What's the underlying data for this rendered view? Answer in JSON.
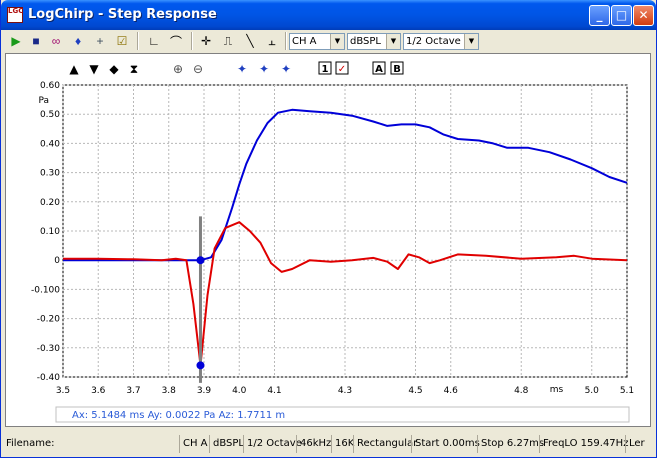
{
  "window": {
    "title": "LogChirp - Step Response",
    "icon_text": "LGC",
    "minimize": "_",
    "maximize": "□",
    "close": "✕"
  },
  "toolbar": {
    "icons": [
      {
        "name": "play-icon",
        "glyph": "▶",
        "color": "#1a9a1a"
      },
      {
        "name": "save-icon",
        "glyph": "■",
        "color": "#1a2a88"
      },
      {
        "name": "loop-icon",
        "glyph": "∞",
        "color": "#a01070"
      },
      {
        "name": "mic-icon",
        "glyph": "♦",
        "color": "#2040c0"
      },
      {
        "name": "crosshair-icon",
        "glyph": "+",
        "color": "#405060"
      },
      {
        "name": "check-icon",
        "glyph": "☑",
        "color": "#8a7000"
      },
      {
        "name": "impulse-axis-icon",
        "glyph": "∟",
        "color": "#000"
      },
      {
        "name": "curve-icon",
        "glyph": "⌒",
        "color": "#000"
      },
      {
        "name": "cursor-cross-icon",
        "glyph": "✛",
        "color": "#000"
      },
      {
        "name": "step-icon",
        "glyph": "⎍",
        "color": "#000"
      },
      {
        "name": "slope-icon",
        "glyph": "╲",
        "color": "#000"
      },
      {
        "name": "waterfall-icon",
        "glyph": "⫠",
        "color": "#000"
      }
    ],
    "channel": "CH A",
    "units": "dBSPL",
    "smoothing": "1/2 Octave"
  },
  "plot_toolbar": {
    "icons": [
      "▲",
      "▼",
      "◆",
      "⧗",
      "⊕",
      "⊖",
      "✦",
      "✦",
      "✦"
    ],
    "box1": "1",
    "box_check": "✓",
    "boxA": "A",
    "boxB": "B"
  },
  "chart_data": {
    "type": "line",
    "title": "",
    "xlabel": "ms",
    "ylabel": "Pa",
    "xlim": [
      3.5,
      5.1
    ],
    "ylim": [
      -0.4,
      0.6
    ],
    "grid": true,
    "x_ticks": [
      3.5,
      3.6,
      3.7,
      3.8,
      3.9,
      4.0,
      4.1,
      4.3,
      4.5,
      4.6,
      4.8,
      5.0,
      5.1
    ],
    "x_tick_labels": [
      "3.5",
      "3.6",
      "3.7",
      "3.8",
      "3.9",
      "4.0",
      "4.1",
      "4.3",
      "4.5",
      "4.6",
      "4.8",
      "5.0",
      "5.1"
    ],
    "y_ticks": [
      0.6,
      0.5,
      0.4,
      0.3,
      0.2,
      0.1,
      0.0,
      -0.1,
      -0.2,
      -0.3,
      -0.4
    ],
    "y_tick_labels": [
      "0.60",
      "0.50",
      "0.40",
      "0.30",
      "0.20",
      "0.10",
      "0",
      "-0.100",
      "-0.20",
      "-0.30",
      "-0.40"
    ],
    "series": [
      {
        "color": "#0000d8",
        "points": [
          [
            3.5,
            0.0
          ],
          [
            3.7,
            0.0
          ],
          [
            3.85,
            0.0
          ],
          [
            3.89,
            0.0
          ],
          [
            3.92,
            0.01
          ],
          [
            3.95,
            0.07
          ],
          [
            3.98,
            0.18
          ],
          [
            4.0,
            0.26
          ],
          [
            4.02,
            0.33
          ],
          [
            4.05,
            0.41
          ],
          [
            4.08,
            0.47
          ],
          [
            4.11,
            0.505
          ],
          [
            4.15,
            0.515
          ],
          [
            4.2,
            0.51
          ],
          [
            4.26,
            0.505
          ],
          [
            4.32,
            0.495
          ],
          [
            4.38,
            0.475
          ],
          [
            4.42,
            0.46
          ],
          [
            4.46,
            0.465
          ],
          [
            4.5,
            0.465
          ],
          [
            4.54,
            0.455
          ],
          [
            4.58,
            0.43
          ],
          [
            4.62,
            0.415
          ],
          [
            4.68,
            0.41
          ],
          [
            4.72,
            0.4
          ],
          [
            4.76,
            0.385
          ],
          [
            4.82,
            0.385
          ],
          [
            4.88,
            0.37
          ],
          [
            4.94,
            0.345
          ],
          [
            5.0,
            0.315
          ],
          [
            5.05,
            0.285
          ],
          [
            5.1,
            0.265
          ]
        ]
      },
      {
        "color": "#e00000",
        "points": [
          [
            3.5,
            0.005
          ],
          [
            3.6,
            0.005
          ],
          [
            3.7,
            0.003
          ],
          [
            3.78,
            0.0
          ],
          [
            3.82,
            0.005
          ],
          [
            3.85,
            0.0
          ],
          [
            3.87,
            -0.15
          ],
          [
            3.89,
            -0.36
          ],
          [
            3.91,
            -0.12
          ],
          [
            3.93,
            0.04
          ],
          [
            3.96,
            0.11
          ],
          [
            4.0,
            0.13
          ],
          [
            4.03,
            0.1
          ],
          [
            4.06,
            0.06
          ],
          [
            4.09,
            -0.01
          ],
          [
            4.12,
            -0.04
          ],
          [
            4.15,
            -0.03
          ],
          [
            4.2,
            0.0
          ],
          [
            4.26,
            -0.005
          ],
          [
            4.32,
            0.0
          ],
          [
            4.38,
            0.008
          ],
          [
            4.42,
            -0.005
          ],
          [
            4.45,
            -0.03
          ],
          [
            4.48,
            0.02
          ],
          [
            4.51,
            0.01
          ],
          [
            4.54,
            -0.01
          ],
          [
            4.57,
            0.0
          ],
          [
            4.62,
            0.02
          ],
          [
            4.7,
            0.015
          ],
          [
            4.8,
            0.005
          ],
          [
            4.9,
            0.01
          ],
          [
            4.95,
            0.015
          ],
          [
            5.0,
            0.005
          ],
          [
            5.1,
            0.0
          ]
        ]
      }
    ],
    "cursor": {
      "x": 3.89,
      "blue_y": 0.0,
      "red_y": -0.36,
      "line_top": 0.15,
      "line_bottom": -0.42
    }
  },
  "readout": {
    "text": "Ax: 5.1484 ms  Ay: 0.0022 Pa   Az: 1.7711 m"
  },
  "status": {
    "filename_label": "Filename:",
    "channel": "CH A",
    "units": "dBSPL",
    "smoothing": "1/2 Octave",
    "rate": "46kHz",
    "fft": "16K",
    "window": "Rectangular",
    "start": "Start 0.00ms",
    "stop": "Stop 6.27ms",
    "freqlo": "FreqLO 159.47Hz",
    "len": "Ler"
  }
}
